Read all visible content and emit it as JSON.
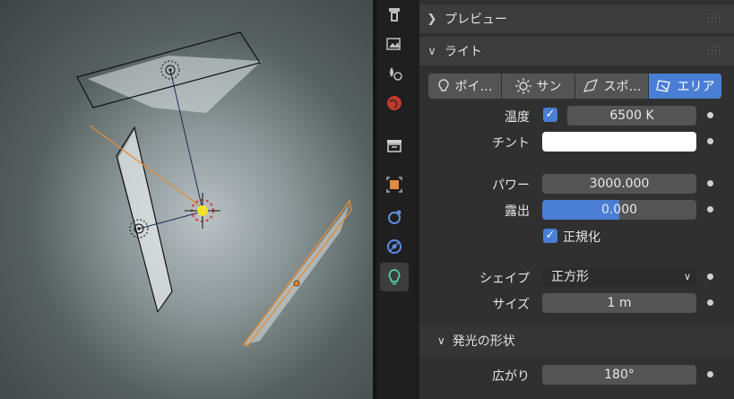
{
  "viewport": {
    "label": "3D Viewport"
  },
  "tabs": [
    {
      "icon": "tool-icon",
      "active": false
    },
    {
      "icon": "render-icon",
      "active": false
    },
    {
      "icon": "output-icon",
      "active": false
    },
    {
      "icon": "world-icon",
      "active": false
    },
    {
      "icon": "collection-icon",
      "active": false
    },
    {
      "icon": "object-icon",
      "active": false
    },
    {
      "icon": "physics-icon",
      "active": false
    },
    {
      "icon": "constraints-icon",
      "active": false
    },
    {
      "icon": "light-data-icon",
      "active": true
    }
  ],
  "preview": {
    "title": "プレビュー"
  },
  "light": {
    "title": "ライト",
    "types": [
      {
        "label": "ポイ…",
        "icon": "point-light-icon",
        "selected": false
      },
      {
        "label": "サン",
        "icon": "sun-light-icon",
        "selected": false
      },
      {
        "label": "スポ…",
        "icon": "spot-light-icon",
        "selected": false
      },
      {
        "label": "エリア",
        "icon": "area-light-icon",
        "selected": true
      }
    ],
    "temperature_label": "温度",
    "temperature_value": "6500 K",
    "tint_label": "チント",
    "power_label": "パワー",
    "power_value": "3000.000",
    "exposure_label": "露出",
    "exposure_value": "0.000",
    "normalize_label": "正規化",
    "shape_label": "シェイプ",
    "shape_value": "正方形",
    "size_label": "サイズ",
    "size_value": "1 m",
    "emission": {
      "title": "発光の形状",
      "spread_label": "広がり",
      "spread_value": "180°"
    }
  },
  "colors": {
    "accent": "#4a7ed4",
    "field": "#545454",
    "tint": "#ffffff",
    "orange": "#e88a2f"
  }
}
